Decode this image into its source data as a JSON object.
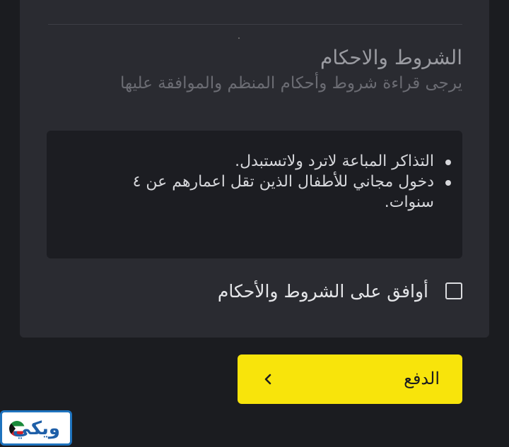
{
  "terms": {
    "title": "الشروط والاحكام",
    "subtitle": "يرجى قراءة شروط وأحكام المنظم والموافقة عليها",
    "items": [
      "التذاكر المباعة لاترد ولاتستبدل.",
      "دخول مجاني للأطفال الذين تقل اعمارهم عن ٤ سنوات."
    ]
  },
  "agreement": {
    "label": "أوافق على الشروط والأحكام",
    "checked": false
  },
  "pay_button": {
    "label": "الدفع",
    "icon": "chevron-left-icon"
  },
  "logo": {
    "text": "ويكي"
  },
  "colors": {
    "background": "#1b1c20",
    "card": "#2a2b31",
    "terms_box": "#1c1d22",
    "accent_yellow": "#f8e40b"
  }
}
